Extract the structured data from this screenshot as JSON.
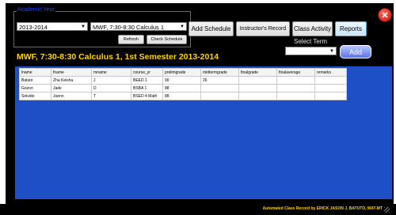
{
  "panel": {
    "title": "Academic Year",
    "year_select": "2013-2014",
    "schedule_select": "MWF, 7:30-8:30 Calculus 1",
    "refresh_label": "Refresh",
    "check_schedule_label": "Check Schedule"
  },
  "toolbar": {
    "add_schedule": "Add Schedule",
    "instructors_record": "Instructor's Record",
    "class_activity": "Class Activity",
    "reports": "Reports"
  },
  "term": {
    "label": "Select Term",
    "value": "",
    "add_label": "Add"
  },
  "heading": "MWF, 7:30-8:30 Calculus 1, 1st Semester 2013-2014",
  "grid": {
    "columns": [
      "lname",
      "fname",
      "mname",
      "course_yr",
      "prelimgrade",
      "midtermgrade",
      "finalgrade",
      "finalaverage",
      "remarks"
    ],
    "rows": [
      [
        "Batuto",
        "Zha Keisha",
        "J",
        "BEED 1",
        "90",
        "26",
        "",
        "",
        ""
      ],
      [
        "Gozon",
        "Jade",
        "D",
        "BSBA 1",
        "88",
        "",
        "",
        "",
        ""
      ],
      [
        "Selvido",
        "Joenn",
        "T",
        "BSED 4 Math",
        "88",
        "",
        "",
        "",
        ""
      ]
    ]
  },
  "footer": "Automated Class Record by ERICK JASON J. BATUTO, MAT-MT",
  "colors": {
    "heading": "#ffd600",
    "grid_bg": "#1f4fc4",
    "panel_title": "#1448ff"
  }
}
